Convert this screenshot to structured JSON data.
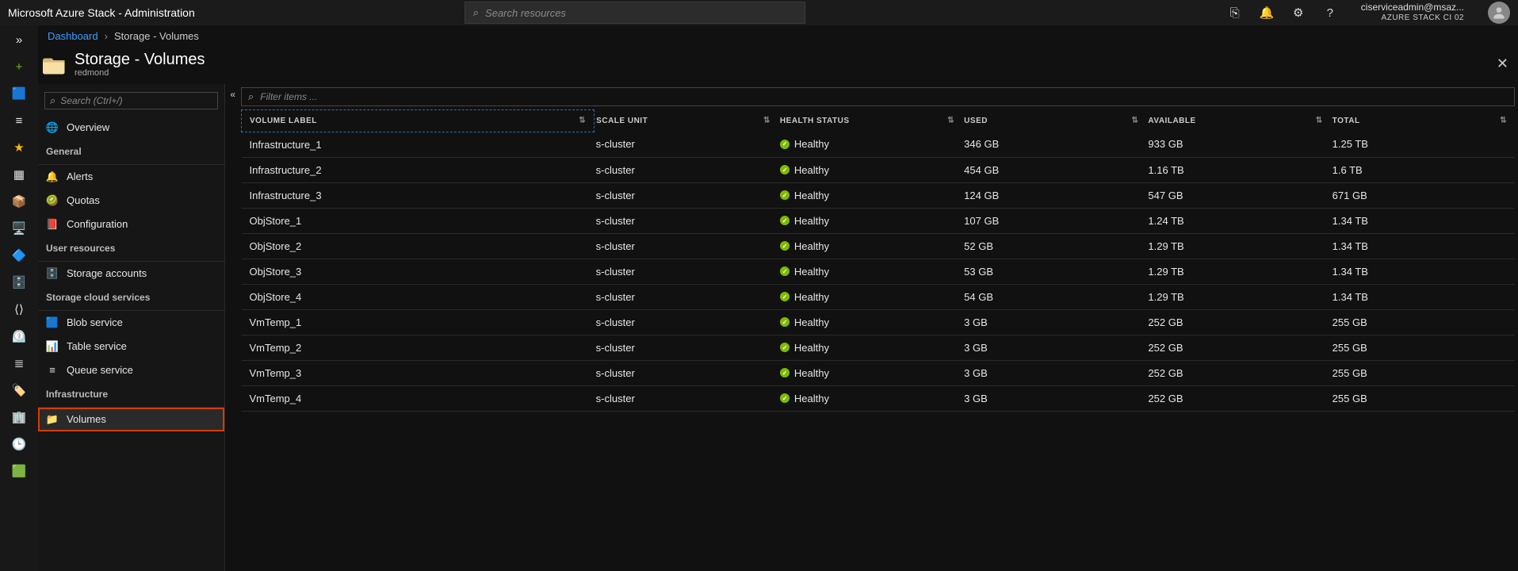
{
  "topbar": {
    "title": "Microsoft Azure Stack - Administration",
    "search_placeholder": "Search resources",
    "account_email": "ciserviceadmin@msaz...",
    "tenant": "AZURE STACK CI 02"
  },
  "breadcrumb": {
    "root": "Dashboard",
    "current": "Storage - Volumes"
  },
  "blade": {
    "title": "Storage - Volumes",
    "subtitle": "redmond",
    "search_placeholder": "Search (Ctrl+/)",
    "filter_placeholder": "Filter items ..."
  },
  "nav": {
    "overview": "Overview",
    "groups": [
      {
        "label": "General",
        "items": [
          {
            "icon": "🔔",
            "label": "Alerts"
          },
          {
            "icon": "🥝",
            "label": "Quotas"
          },
          {
            "icon": "📕",
            "label": "Configuration"
          }
        ]
      },
      {
        "label": "User resources",
        "items": [
          {
            "icon": "🗄️",
            "label": "Storage accounts"
          }
        ]
      },
      {
        "label": "Storage cloud services",
        "items": [
          {
            "icon": "🟦",
            "label": "Blob service"
          },
          {
            "icon": "📊",
            "label": "Table service"
          },
          {
            "icon": "≡",
            "label": "Queue service"
          }
        ]
      },
      {
        "label": "Infrastructure",
        "items": [
          {
            "icon": "📁",
            "label": "Volumes",
            "active": true
          }
        ]
      }
    ]
  },
  "columns": [
    "VOLUME LABEL",
    "SCALE UNIT",
    "HEALTH STATUS",
    "USED",
    "AVAILABLE",
    "TOTAL"
  ],
  "rows": [
    {
      "label": "Infrastructure_1",
      "unit": "s-cluster",
      "health": "Healthy",
      "used": "346 GB",
      "avail": "933 GB",
      "total": "1.25 TB"
    },
    {
      "label": "Infrastructure_2",
      "unit": "s-cluster",
      "health": "Healthy",
      "used": "454 GB",
      "avail": "1.16 TB",
      "total": "1.6 TB"
    },
    {
      "label": "Infrastructure_3",
      "unit": "s-cluster",
      "health": "Healthy",
      "used": "124 GB",
      "avail": "547 GB",
      "total": "671 GB"
    },
    {
      "label": "ObjStore_1",
      "unit": "s-cluster",
      "health": "Healthy",
      "used": "107 GB",
      "avail": "1.24 TB",
      "total": "1.34 TB"
    },
    {
      "label": "ObjStore_2",
      "unit": "s-cluster",
      "health": "Healthy",
      "used": "52 GB",
      "avail": "1.29 TB",
      "total": "1.34 TB"
    },
    {
      "label": "ObjStore_3",
      "unit": "s-cluster",
      "health": "Healthy",
      "used": "53 GB",
      "avail": "1.29 TB",
      "total": "1.34 TB"
    },
    {
      "label": "ObjStore_4",
      "unit": "s-cluster",
      "health": "Healthy",
      "used": "54 GB",
      "avail": "1.29 TB",
      "total": "1.34 TB"
    },
    {
      "label": "VmTemp_1",
      "unit": "s-cluster",
      "health": "Healthy",
      "used": "3 GB",
      "avail": "252 GB",
      "total": "255 GB"
    },
    {
      "label": "VmTemp_2",
      "unit": "s-cluster",
      "health": "Healthy",
      "used": "3 GB",
      "avail": "252 GB",
      "total": "255 GB"
    },
    {
      "label": "VmTemp_3",
      "unit": "s-cluster",
      "health": "Healthy",
      "used": "3 GB",
      "avail": "252 GB",
      "total": "255 GB"
    },
    {
      "label": "VmTemp_4",
      "unit": "s-cluster",
      "health": "Healthy",
      "used": "3 GB",
      "avail": "252 GB",
      "total": "255 GB"
    }
  ],
  "rail_icons": [
    "»",
    "+",
    "🟦",
    "≡",
    "★",
    "▦",
    "📦",
    "🖥️",
    "🔷",
    "🗄️",
    "⟨⟩",
    "⏲️",
    "≣",
    "🏷️",
    "🏢",
    "🕒",
    "🟩"
  ]
}
